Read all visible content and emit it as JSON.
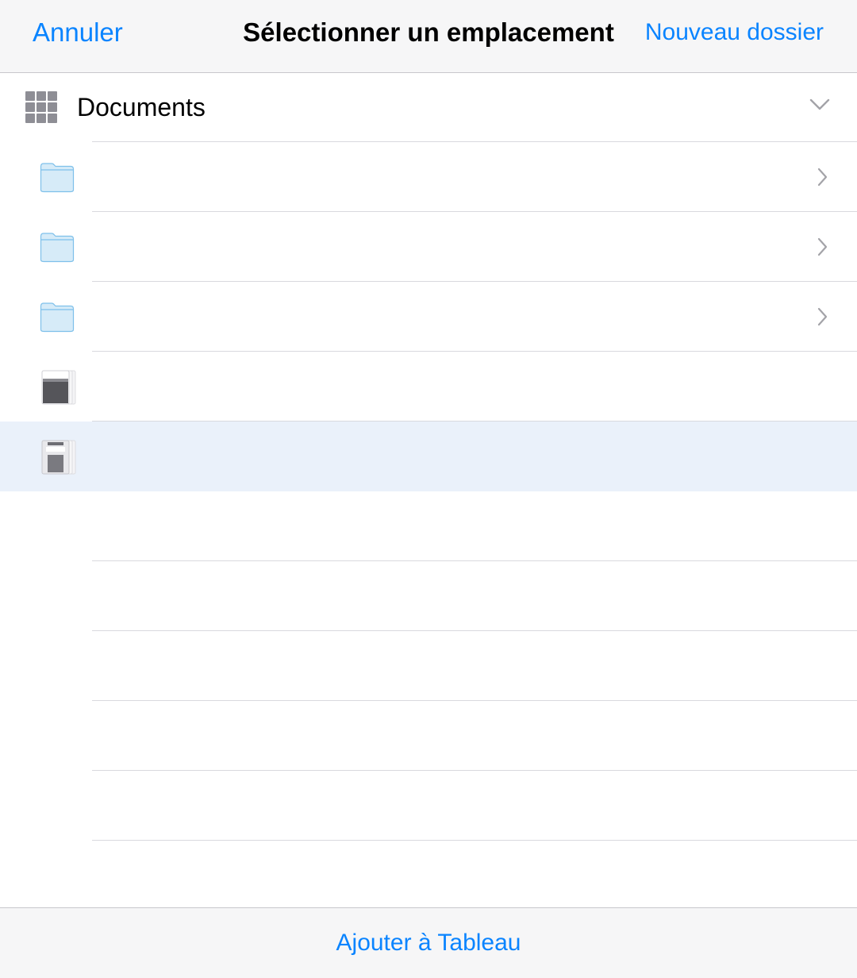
{
  "nav": {
    "cancel_label": "Annuler",
    "title": "Sélectionner un emplacement",
    "new_folder_label": "Nouveau dossier"
  },
  "location": {
    "label": "Documents",
    "icon": "grid-icon",
    "expand_icon": "chevron-down-icon"
  },
  "items": [
    {
      "type": "folder",
      "icon": "folder-icon",
      "name": "",
      "has_disclosure": true
    },
    {
      "type": "folder",
      "icon": "folder-icon",
      "name": "",
      "has_disclosure": true
    },
    {
      "type": "folder",
      "icon": "folder-icon",
      "name": "",
      "has_disclosure": true
    },
    {
      "type": "document",
      "icon": "document-icon",
      "name": "",
      "has_disclosure": false
    },
    {
      "type": "document",
      "icon": "document-icon",
      "name": "",
      "has_disclosure": false,
      "selected": true
    }
  ],
  "toolbar": {
    "add_label": "Ajouter à Tableau"
  },
  "colors": {
    "accent": "#0a84ff",
    "selected_row": "#eaf1fa",
    "folder_fill": "#d6ebf8",
    "folder_stroke": "#7ec0ea"
  }
}
